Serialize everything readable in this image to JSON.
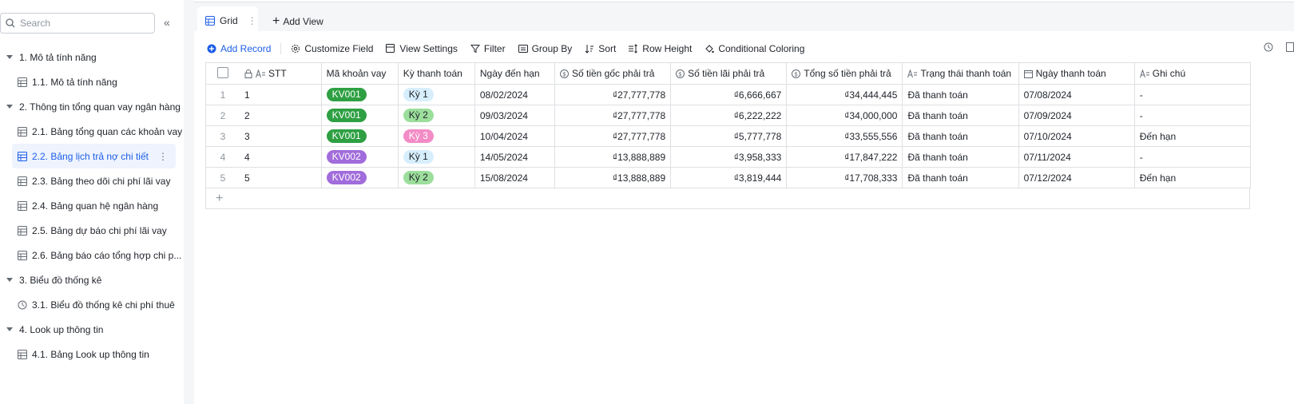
{
  "sidebar": {
    "search_placeholder": "Search",
    "collapse_icon": "double-chevron-left-icon",
    "tree": [
      {
        "type": "group",
        "label": "1. Mô tả tính năng"
      },
      {
        "type": "item",
        "label": "1.1. Mô tả tính năng",
        "icon": "table-icon"
      },
      {
        "type": "group",
        "label": "2. Thông tin tổng quan vay ngân hàng"
      },
      {
        "type": "item",
        "label": "2.1. Bảng tổng quan các khoản vay",
        "icon": "table-icon"
      },
      {
        "type": "item",
        "label": "2.2. Bảng lịch trả nợ chi tiết",
        "icon": "table-icon",
        "active": true
      },
      {
        "type": "item",
        "label": "2.3. Bảng theo dõi chi phí lãi vay",
        "icon": "table-icon"
      },
      {
        "type": "item",
        "label": "2.4. Bảng quan hệ ngân hàng",
        "icon": "table-icon"
      },
      {
        "type": "item",
        "label": "2.5. Bảng dự báo chi phí lãi vay",
        "icon": "table-icon"
      },
      {
        "type": "item",
        "label": "2.6. Bảng báo cáo tổng hợp chi p...",
        "icon": "table-icon"
      },
      {
        "type": "group",
        "label": "3. Biểu đồ thống kê"
      },
      {
        "type": "item",
        "label": "3.1. Biểu đồ thống kê chi phí thuê",
        "icon": "dashboard-icon"
      },
      {
        "type": "group",
        "label": "4. Look up thông tin"
      },
      {
        "type": "item",
        "label": "4.1. Bảng Look up thông tin",
        "icon": "table-icon"
      }
    ]
  },
  "views": {
    "grid_tab": "Grid",
    "add_view": "Add View"
  },
  "toolbar": {
    "add_record": "Add Record",
    "customize_field": "Customize Field",
    "view_settings": "View Settings",
    "filter": "Filter",
    "group_by": "Group By",
    "sort": "Sort",
    "row_height": "Row Height",
    "conditional_coloring": "Conditional Coloring"
  },
  "table": {
    "headers": [
      "STT",
      "Mã khoản vay",
      "Kỳ thanh toán",
      "Ngày đến hạn",
      "Số tiền gốc phải trả",
      "Số tiền lãi phải trả",
      "Tổng số tiền phải trả",
      "Trạng thái thanh toán",
      "Ngày thanh toán",
      "Ghi chú"
    ],
    "rows": [
      {
        "n": "1",
        "stt": "1",
        "ma": "KV001",
        "ky": "Kỳ 1",
        "den_han": "08/02/2024",
        "goc": "₫27,777,778",
        "lai": "₫6,666,667",
        "tong": "₫34,444,445",
        "trang_thai": "Đã thanh toán",
        "ngay_tt": "07/08/2024",
        "ghi_chu": "-"
      },
      {
        "n": "2",
        "stt": "2",
        "ma": "KV001",
        "ky": "Kỳ 2",
        "den_han": "09/03/2024",
        "goc": "₫27,777,778",
        "lai": "₫6,222,222",
        "tong": "₫34,000,000",
        "trang_thai": "Đã thanh toán",
        "ngay_tt": "07/09/2024",
        "ghi_chu": "-"
      },
      {
        "n": "3",
        "stt": "3",
        "ma": "KV001",
        "ky": "Kỳ 3",
        "den_han": "10/04/2024",
        "goc": "₫27,777,778",
        "lai": "₫5,777,778",
        "tong": "₫33,555,556",
        "trang_thai": "Đã thanh toán",
        "ngay_tt": "07/10/2024",
        "ghi_chu": "Đến hạn"
      },
      {
        "n": "4",
        "stt": "4",
        "ma": "KV002",
        "ky": "Kỳ 1",
        "den_han": "14/05/2024",
        "goc": "₫13,888,889",
        "lai": "₫3,958,333",
        "tong": "₫17,847,222",
        "trang_thai": "Đã thanh toán",
        "ngay_tt": "07/11/2024",
        "ghi_chu": "-"
      },
      {
        "n": "5",
        "stt": "5",
        "ma": "KV002",
        "ky": "Kỳ 2",
        "den_han": "15/08/2024",
        "goc": "₫13,888,889",
        "lai": "₫3,819,444",
        "tong": "₫17,708,333",
        "trang_thai": "Đã thanh toán",
        "ngay_tt": "07/12/2024",
        "ghi_chu": "Đến hạn"
      }
    ],
    "add_row": "+"
  }
}
